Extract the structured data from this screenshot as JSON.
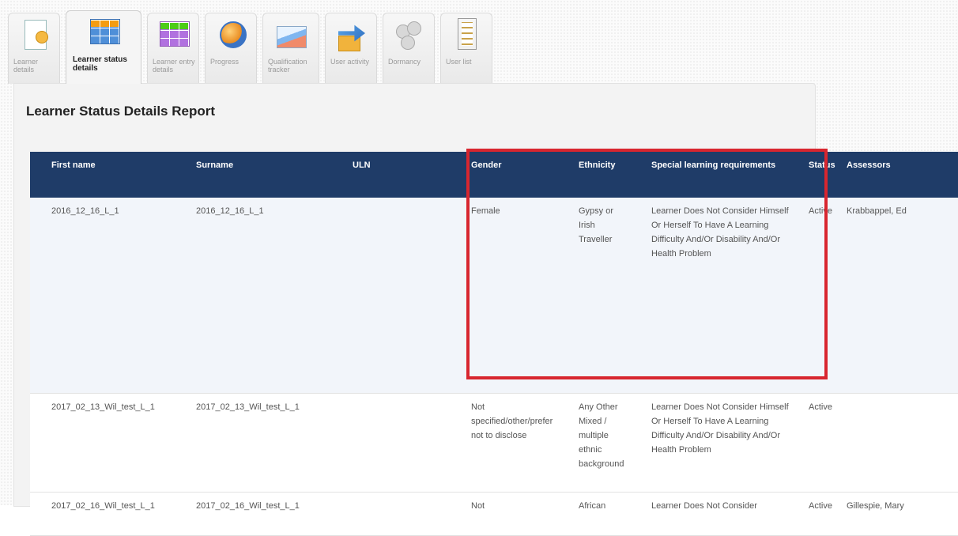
{
  "tabs": [
    {
      "label": "Learner details",
      "icon": "learner-details-icon"
    },
    {
      "label": "Learner status details",
      "icon": "status-grid-icon",
      "active": true
    },
    {
      "label": "Learner entry details",
      "icon": "entry-grid-icon"
    },
    {
      "label": "Progress",
      "icon": "globe-icon"
    },
    {
      "label": "Qualification tracker",
      "icon": "chart-icon"
    },
    {
      "label": "User activity",
      "icon": "activity-arrow-icon"
    },
    {
      "label": "Dormancy",
      "icon": "people-icon"
    },
    {
      "label": "User list",
      "icon": "list-icon"
    }
  ],
  "page_title": "Learner Status Details Report",
  "table": {
    "headers": [
      "First name",
      "Surname",
      "ULN",
      "Gender",
      "Ethnicity",
      "Special learning requirements",
      "Status",
      "Assessors"
    ],
    "rows": [
      [
        "2016_12_16_L_1",
        "2016_12_16_L_1",
        "",
        "Female",
        "Gypsy or Irish Traveller",
        "Learner Does Not Consider Himself Or Herself To Have A Learning Difficulty And/Or Disability And/Or Health Problem",
        "Active",
        "Krabbappel, Ed"
      ],
      [
        "2017_02_13_Wil_test_L_1",
        "2017_02_13_Wil_test_L_1",
        "",
        "Not specified/other/prefer not to disclose",
        "Any Other Mixed / multiple ethnic background",
        "Learner Does Not Consider Himself Or Herself To Have A Learning Difficulty And/Or Disability And/Or Health Problem",
        "Active",
        ""
      ],
      [
        "2017_02_16_Wil_test_L_1",
        "2017_02_16_Wil_test_L_1",
        "",
        "Not",
        "African",
        "Learner Does Not Consider",
        "Active",
        "Gillespie, Mary"
      ]
    ]
  },
  "colors": {
    "header_bg": "#1f3c68",
    "highlight": "#d8262f"
  }
}
